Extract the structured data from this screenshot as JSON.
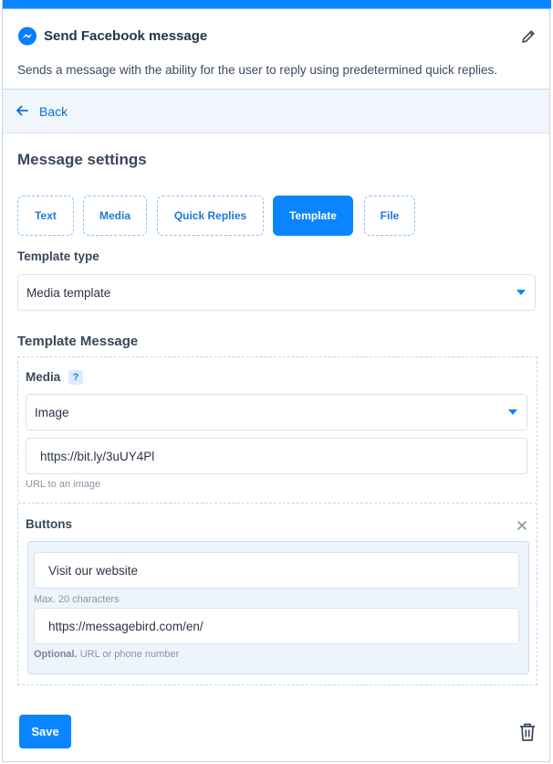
{
  "header": {
    "title": "Send Facebook message",
    "description": "Sends a message with the ability for the user to reply using predetermined quick replies.",
    "icons": {
      "app": "messenger-icon",
      "edit": "pencil-icon"
    }
  },
  "nav": {
    "back_label": "Back",
    "back_icon": "arrow-left-icon"
  },
  "settings": {
    "title": "Message settings",
    "tabs": [
      {
        "label": "Text",
        "active": false
      },
      {
        "label": "Media",
        "active": false
      },
      {
        "label": "Quick Replies",
        "active": false
      },
      {
        "label": "Template",
        "active": true
      },
      {
        "label": "File",
        "active": false
      }
    ]
  },
  "template_type": {
    "label": "Template type",
    "value": "Media template"
  },
  "template_message": {
    "title": "Template Message",
    "media": {
      "label": "Media",
      "help": "?",
      "type_value": "Image",
      "url_value": "https://bit.ly/3uUY4Pl",
      "url_hint": "URL to an image"
    },
    "buttons": {
      "label": "Buttons",
      "close": "×",
      "title_value": "Visit our website",
      "title_hint": "Max. 20 characters",
      "url_value": "https://messagebird.com/en/",
      "url_hint_bold": "Optional.",
      "url_hint": " URL or phone number"
    }
  },
  "actions": {
    "save_label": "Save",
    "delete_icon": "trash-icon"
  },
  "colors": {
    "accent": "#0a85ff",
    "link": "#0a6fd8",
    "backbar": "#f1f6fc"
  }
}
